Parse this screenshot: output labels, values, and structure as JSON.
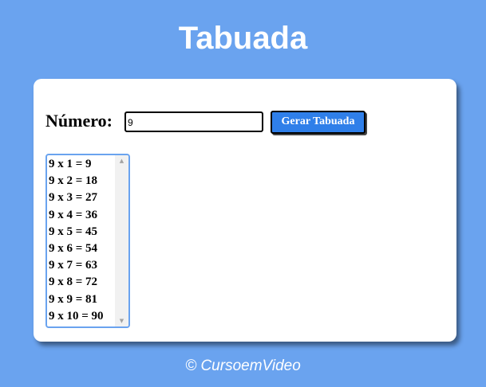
{
  "header": {
    "title": "Tabuada"
  },
  "form": {
    "number_label": "Número:",
    "number_value": "9",
    "generate_button_label": "Gerar Tabuada"
  },
  "results": {
    "options": [
      "9 x 1 = 9",
      "9 x 2 = 18",
      "9 x 3 = 27",
      "9 x 4 = 36",
      "9 x 5 = 45",
      "9 x 6 = 54",
      "9 x 7 = 63",
      "9 x 8 = 72",
      "9 x 9 = 81",
      "9 x 10 = 90"
    ],
    "scroll_up_icon": "triangle-up-icon",
    "scroll_down_icon": "triangle-down-icon"
  },
  "footer": {
    "credit": "© CursoemVideo"
  },
  "colors": {
    "background": "#6aa3ef",
    "button": "#2f7fe9",
    "card": "#ffffff"
  }
}
